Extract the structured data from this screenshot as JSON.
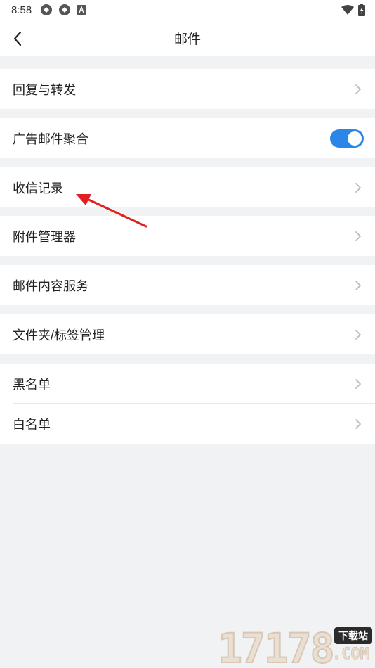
{
  "status_bar": {
    "time": "8:58",
    "left_icons": [
      "sync-icon",
      "sync-icon",
      "text-a-icon"
    ],
    "right_icons": [
      "wifi-icon",
      "battery-icon"
    ]
  },
  "nav": {
    "back_icon": "chevron-left-icon",
    "title": "邮件"
  },
  "settings": {
    "reply_forward": "回复与转发",
    "ad_mail_aggregate": "广告邮件聚合",
    "ad_mail_aggregate_enabled": true,
    "receive_log": "收信记录",
    "attachment_manager": "附件管理器",
    "mail_content_service": "邮件内容服务",
    "folder_tag_manage": "文件夹/标签管理",
    "blacklist": "黑名单",
    "whitelist": "白名单"
  },
  "colors": {
    "accent": "#2b86e8",
    "background": "#f1f2f4",
    "annotation_arrow": "#e02020"
  },
  "watermark": {
    "number": "17178",
    "badge": "下载站",
    "suffix": ".COM"
  }
}
